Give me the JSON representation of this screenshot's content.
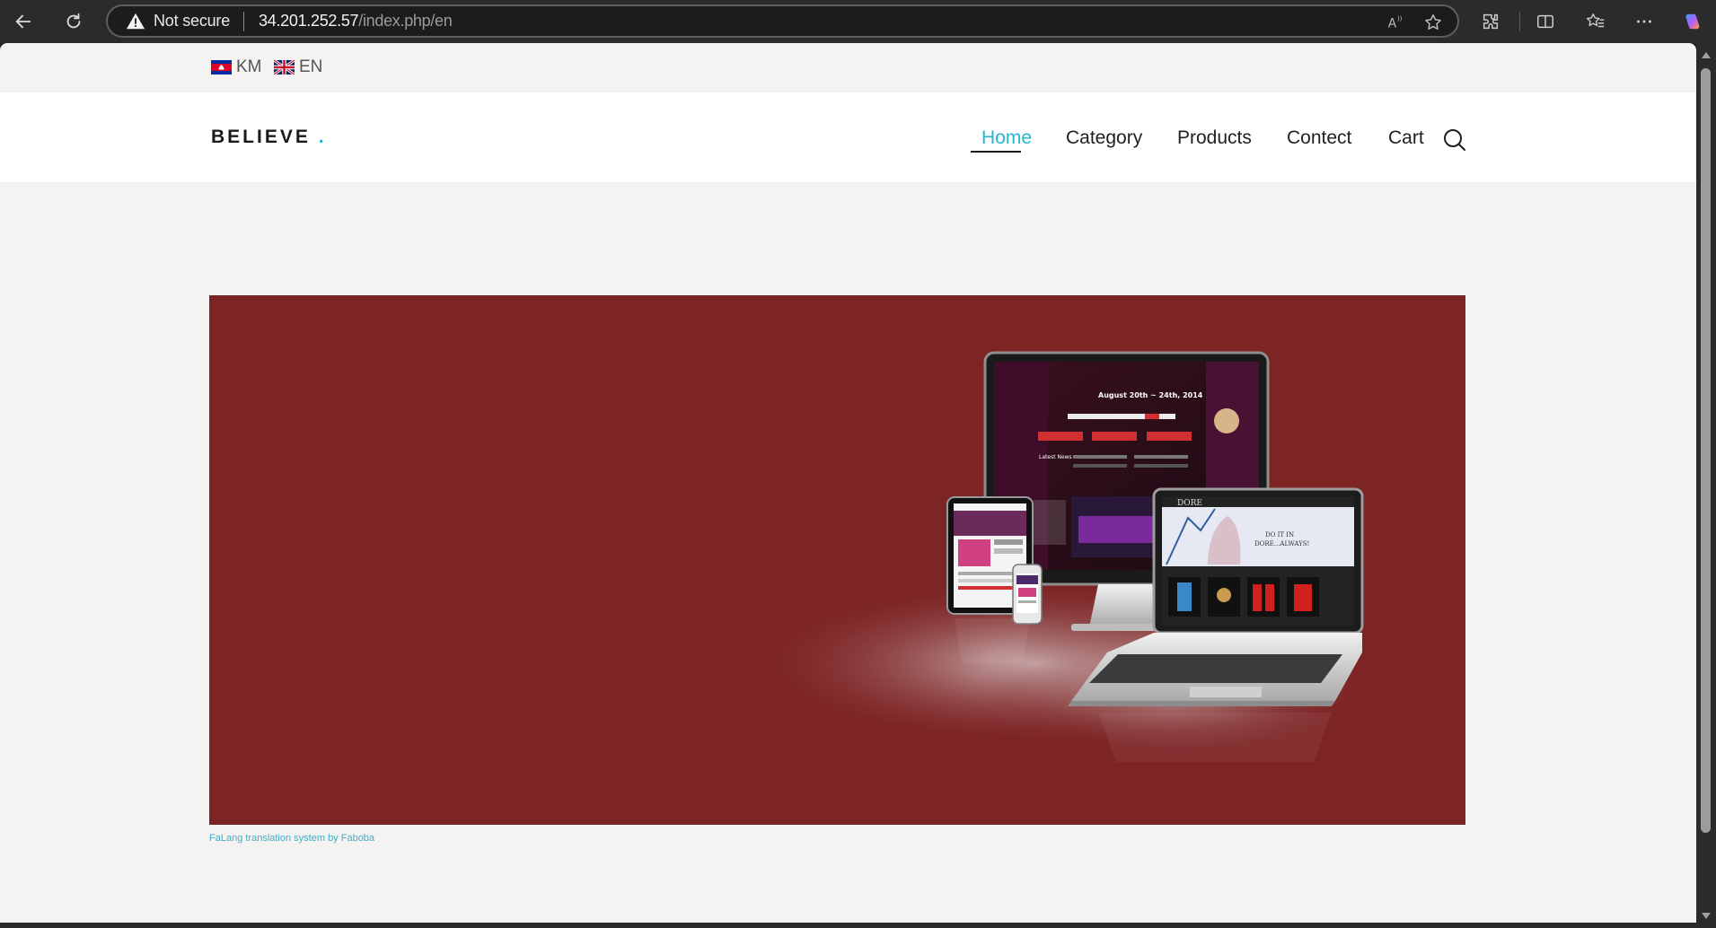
{
  "browser": {
    "security_label": "Not secure",
    "url_host": "34.201.252.57",
    "url_path": "/index.php/en"
  },
  "languages": [
    {
      "code": "KM"
    },
    {
      "code": "EN"
    }
  ],
  "site": {
    "logo_text": "BELIEVE",
    "logo_dot": "."
  },
  "nav": {
    "home": "Home",
    "category": "Category",
    "products": "Products",
    "contact": "Contect",
    "cart": "Cart"
  },
  "hero": {
    "monitor_date": "August 20th ~ 24th, 2014",
    "monitor_section": "Latest News",
    "laptop_tagline_1": "DO IT IN",
    "laptop_tagline_2": "DORE...ALWAYS!",
    "laptop_brand": "DORE",
    "background_color": "#7d2425"
  },
  "footer": {
    "credit": "FaLang translation system by Faboba"
  },
  "colors": {
    "accent": "#26b5cf",
    "hero_bg": "#7d2425",
    "chrome_bg": "#2b2b2b"
  }
}
